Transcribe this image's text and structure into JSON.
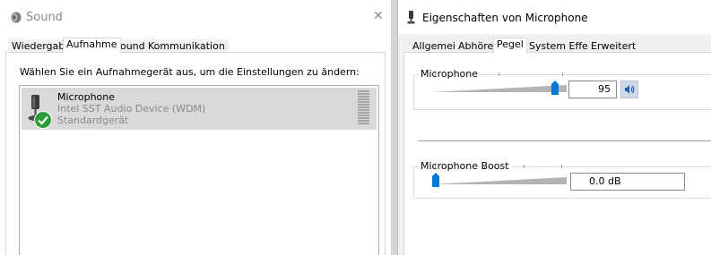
{
  "left_window": {
    "title": "Sound",
    "close_glyph": "✕",
    "tabs": [
      {
        "label": "Wiedergabe",
        "active": false
      },
      {
        "label": "Aufnahme",
        "active": true
      },
      {
        "label": "Sounds",
        "active": false
      },
      {
        "label": "Kommunikation",
        "active": false
      }
    ],
    "instruction": "Wählen Sie ein Aufnahmegerät aus, um die Einstellungen zu ändern:",
    "device": {
      "name": "Microphone",
      "driver": "Intel SST Audio Device (WDM)",
      "status": "Standardgerät",
      "icon": "microphone-icon",
      "badge_icon": "default-checkmark-icon",
      "badge_color": "#2a9d3a"
    }
  },
  "right_window": {
    "title": "Eigenschaften von Microphone",
    "tabs": [
      {
        "label": "Allgemein",
        "active": false
      },
      {
        "label": "Abhören",
        "active": false
      },
      {
        "label": "Pegel",
        "active": true
      },
      {
        "label": "System Effects",
        "active": false
      },
      {
        "label": "Erweitert",
        "active": false
      }
    ],
    "microphone_level": {
      "label": "Microphone",
      "value": "95",
      "level_fraction": 0.95,
      "mute_icon": "speaker-volume-icon"
    },
    "boost": {
      "label": "Microphone Boost",
      "value": "0.0 dB",
      "level_fraction": 0.0
    },
    "accent_color": "#0078d7"
  }
}
